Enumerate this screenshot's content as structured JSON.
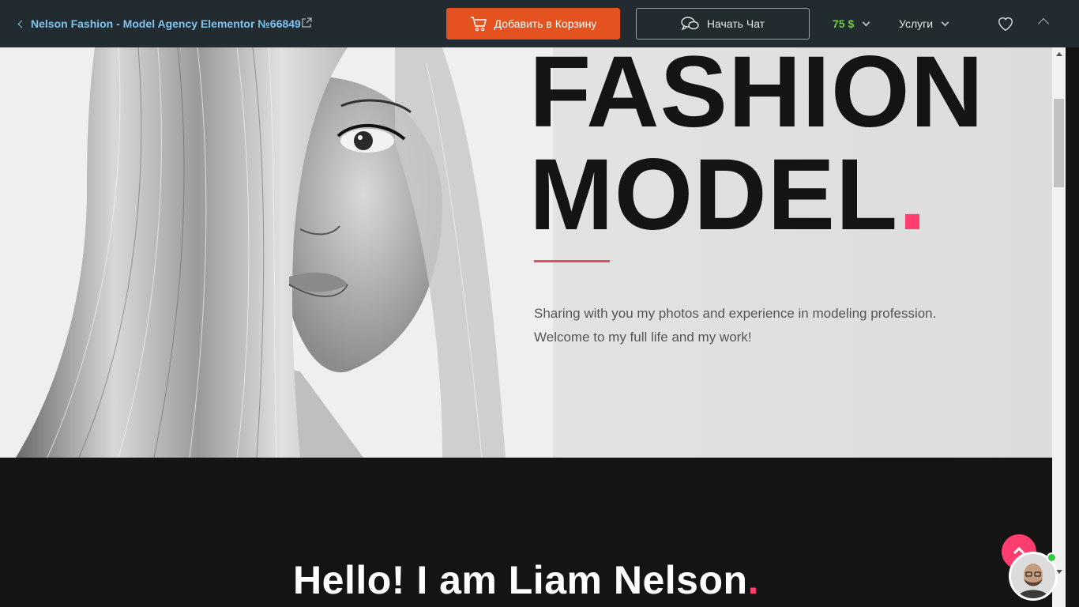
{
  "topbar": {
    "product_title": "Nelson Fashion - Model Agency Elementor №66849",
    "cart_label": "Добавить в Корзину",
    "chat_label": "Начать Чат",
    "price": "75 $",
    "services_label": "Услуги"
  },
  "hero": {
    "title_line1": "FASHION",
    "title_line2": "MODEL",
    "title_dot": ".",
    "description_line1": "Sharing with you my photos and experience in modeling profession.",
    "description_line2": "Welcome to my full life and my work!"
  },
  "about": {
    "heading": "Hello! I am Liam Nelson",
    "heading_dot": "."
  },
  "colors": {
    "topbar_bg": "#222b30",
    "cart_button": "#e4531f",
    "price": "#6fcf3d",
    "accent_pink": "#ff3d6e",
    "dark_section": "#141414"
  },
  "icons": [
    "chevron-left-icon",
    "external-link-icon",
    "cart-icon",
    "chat-icon",
    "chevron-down-icon",
    "heart-icon",
    "chevron-up-icon",
    "arrow-up-icon"
  ]
}
